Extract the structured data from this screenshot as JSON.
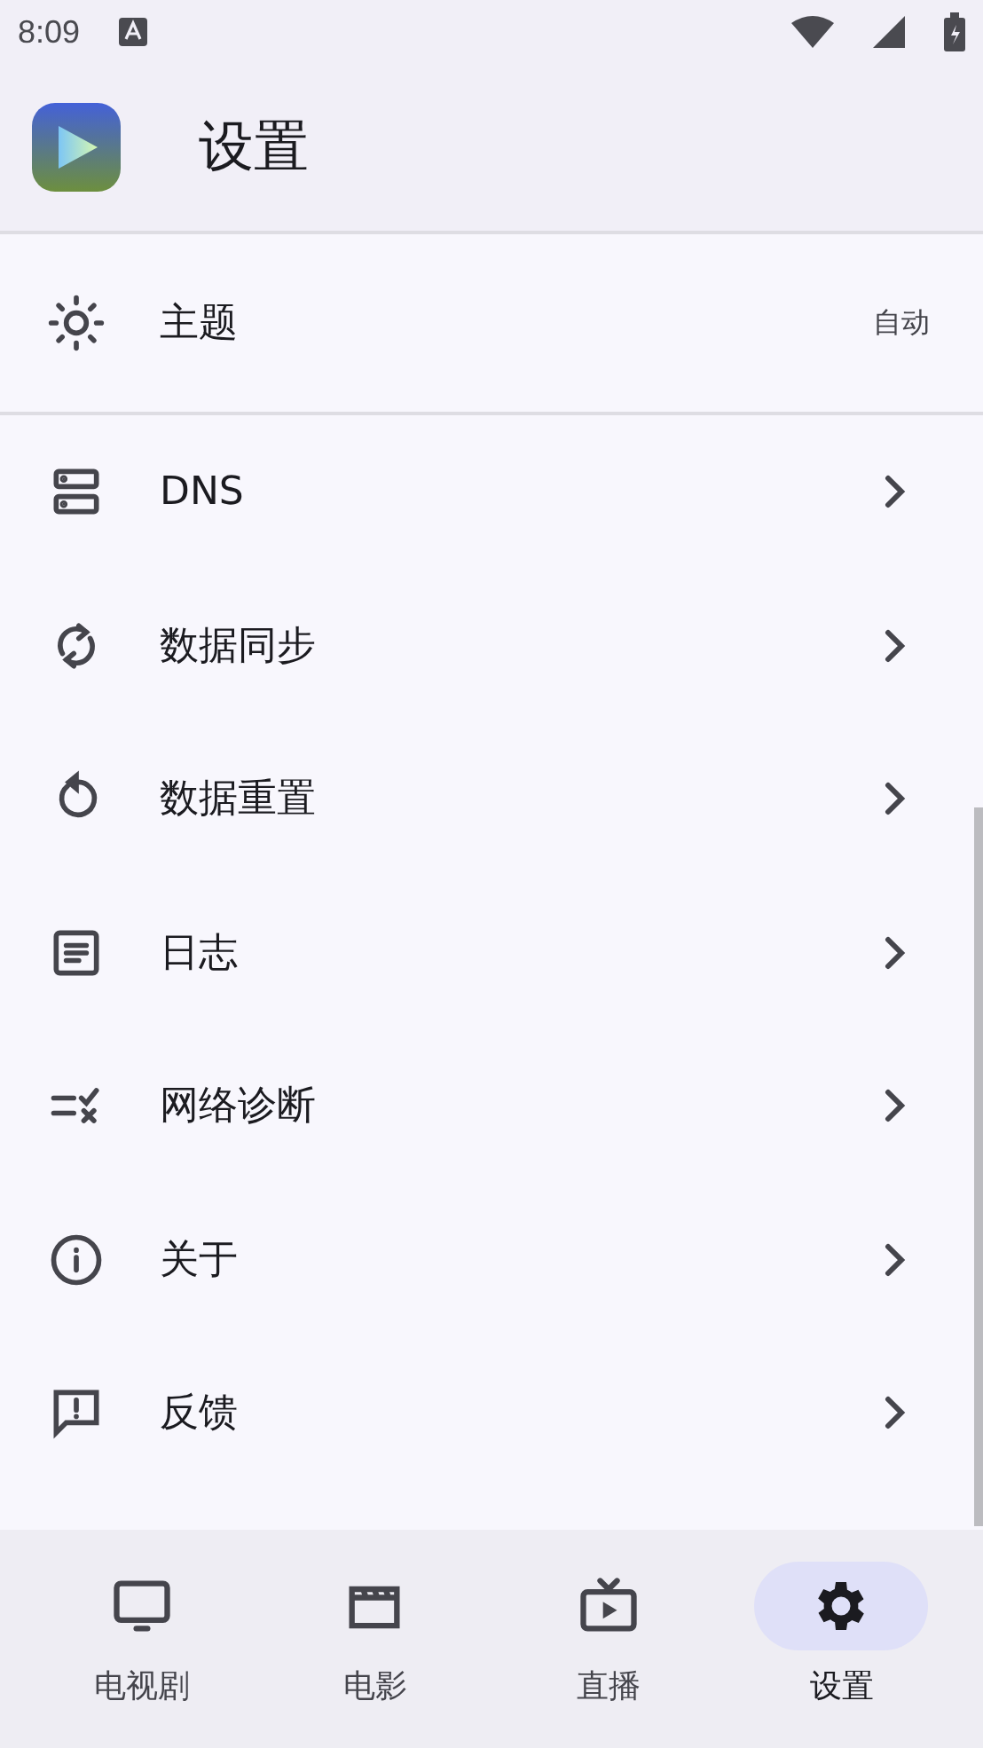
{
  "status_bar": {
    "time": "8:09"
  },
  "header": {
    "title": "设置"
  },
  "settings": [
    {
      "kind": "value",
      "label": "主题",
      "value": "自动"
    },
    {
      "kind": "link",
      "label": "DNS"
    },
    {
      "kind": "link",
      "label": "数据同步"
    },
    {
      "kind": "link",
      "label": "数据重置"
    },
    {
      "kind": "link",
      "label": "日志"
    },
    {
      "kind": "link",
      "label": "网络诊断"
    },
    {
      "kind": "link",
      "label": "关于"
    },
    {
      "kind": "link",
      "label": "反馈"
    }
  ],
  "bottom_nav": [
    {
      "label": "电视剧",
      "selected": false
    },
    {
      "label": "电影",
      "selected": false
    },
    {
      "label": "直播",
      "selected": false
    },
    {
      "label": "设置",
      "selected": true
    }
  ]
}
